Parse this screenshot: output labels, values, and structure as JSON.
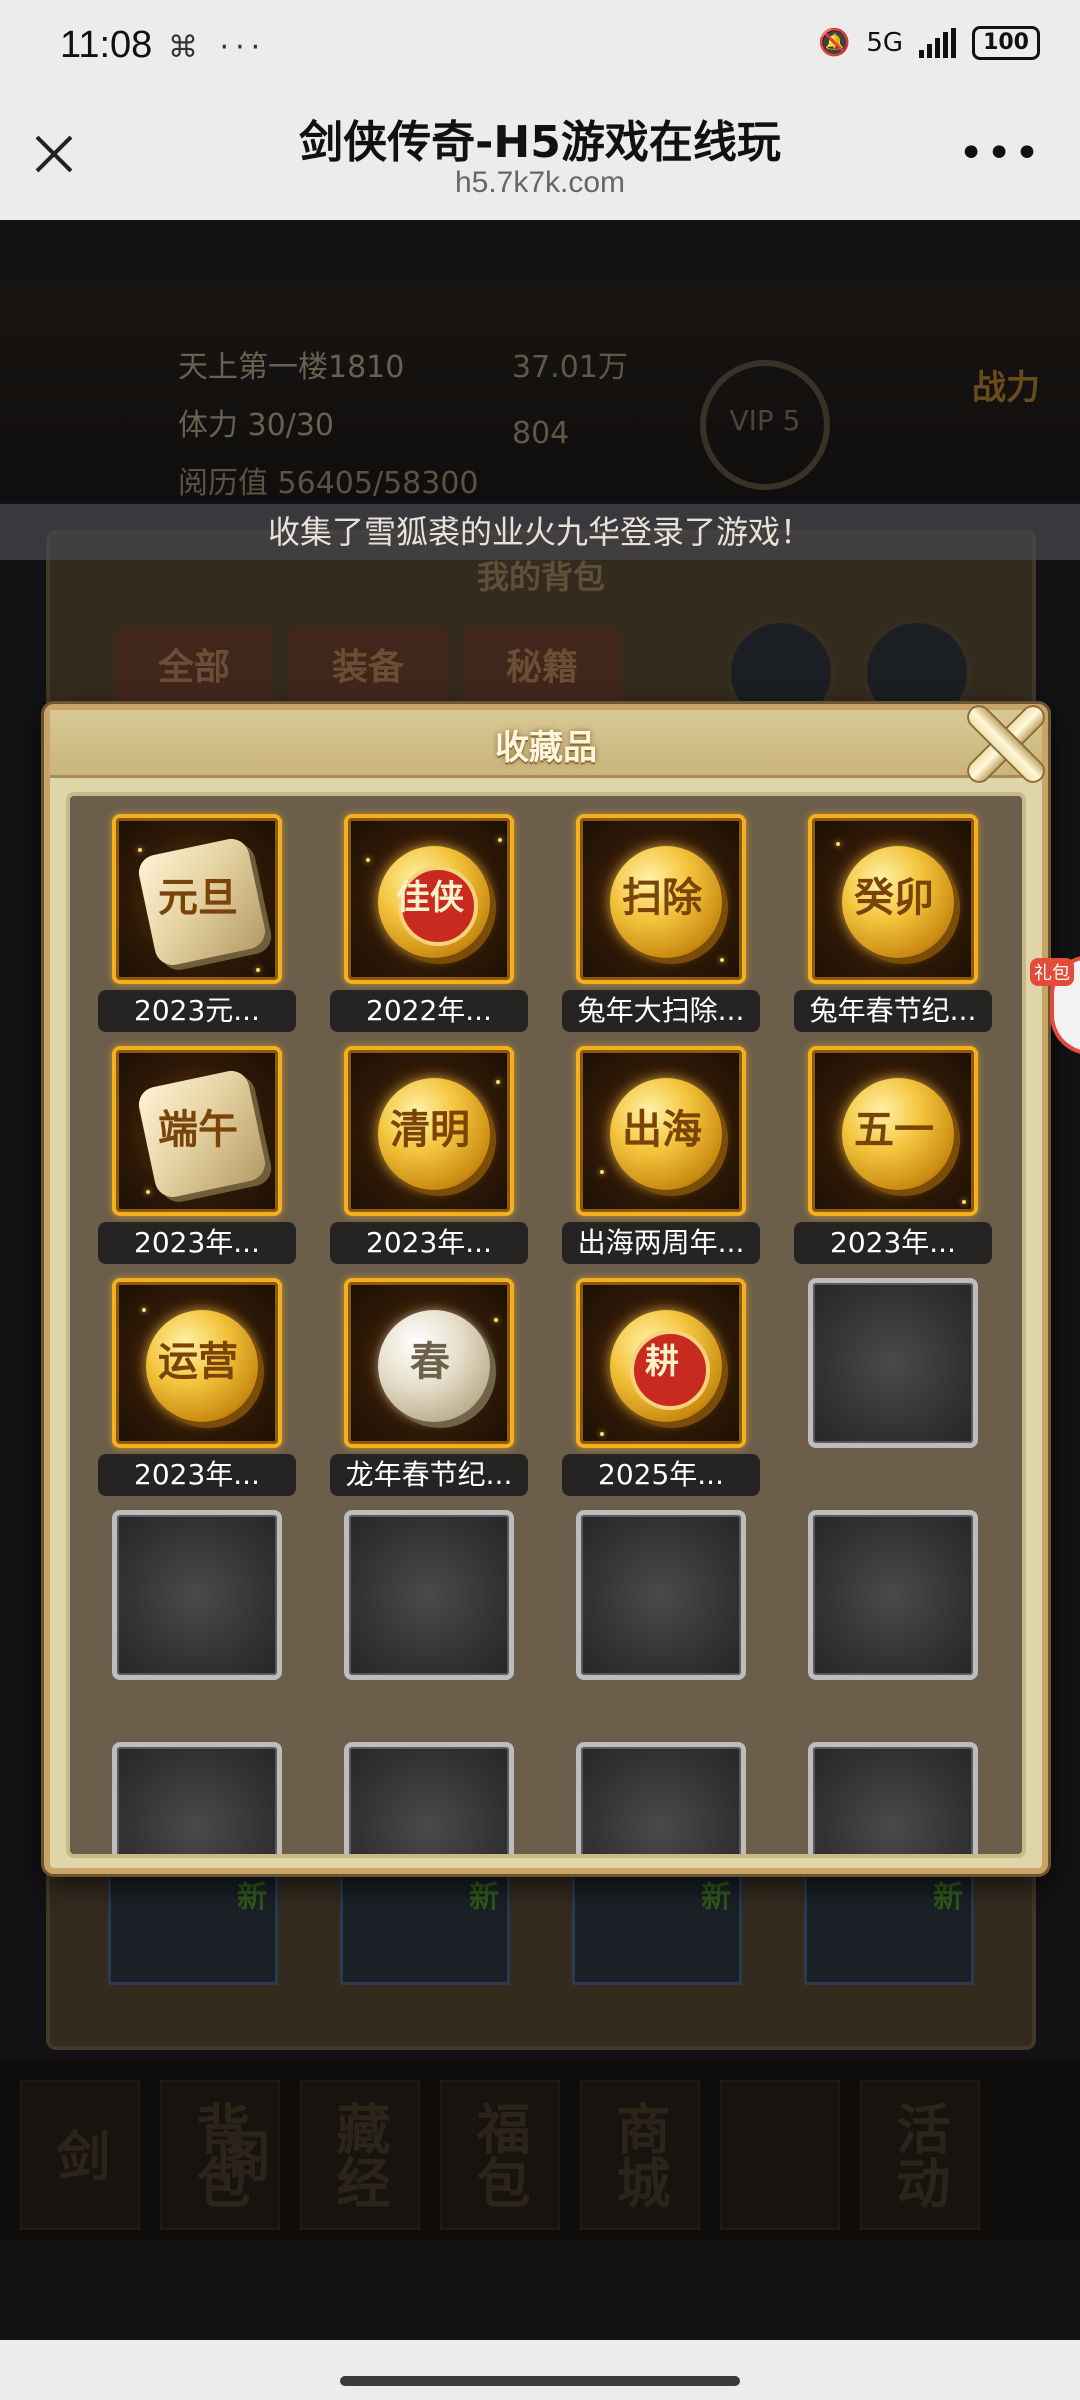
{
  "status_bar": {
    "time": "11:08",
    "left_icons": "⌘ ···",
    "network": "5G",
    "battery": "100"
  },
  "browser": {
    "title": "剑侠传奇-H5游戏在线玩",
    "url": "h5.7k7k.com",
    "more": "•••"
  },
  "game": {
    "player_name": "天上第一楼1810",
    "stamina": "体力 30/30",
    "exp": "阅历值 56405/58300",
    "coins": "37.01万",
    "gems": "804",
    "vip": "VIP 5",
    "power": "战力",
    "notice": "收集了雪狐裘的业火九华登录了游戏！",
    "bag": {
      "title": "我的背包",
      "tabs": [
        "全部",
        "装备",
        "秘籍"
      ]
    },
    "bag_slot_badge": "新",
    "nav": [
      "剑",
      "背包",
      "藏经阁",
      "福包",
      "商城",
      "",
      "活动"
    ]
  },
  "modal": {
    "title": "收藏品",
    "items": [
      {
        "label": "2023元...",
        "glyph": "元旦",
        "style": "plate"
      },
      {
        "label": "2022年...",
        "glyph": "佳侠",
        "style": "red"
      },
      {
        "label": "兔年大扫除...",
        "glyph": "扫除",
        "style": "gold"
      },
      {
        "label": "兔年春节纪...",
        "glyph": "癸卯",
        "style": "gold"
      },
      {
        "label": "2023年...",
        "glyph": "端午",
        "style": "plate"
      },
      {
        "label": "2023年...",
        "glyph": "清明",
        "style": "gold"
      },
      {
        "label": "出海两周年...",
        "glyph": "出海",
        "style": "gold"
      },
      {
        "label": "2023年...",
        "glyph": "五一",
        "style": "gold"
      },
      {
        "label": "2023年...",
        "glyph": "运营",
        "style": "gold"
      },
      {
        "label": "龙年春节纪...",
        "glyph": "春",
        "style": "silver"
      },
      {
        "label": "2025年...",
        "glyph": "耕",
        "style": "red"
      }
    ],
    "empty_slots": 9
  },
  "side_gift": {
    "tag": "礼包"
  },
  "colors": {
    "gold_border": "#f5b11d",
    "empty_border": "#bdbdbd",
    "panel": "#6b5e4a"
  }
}
